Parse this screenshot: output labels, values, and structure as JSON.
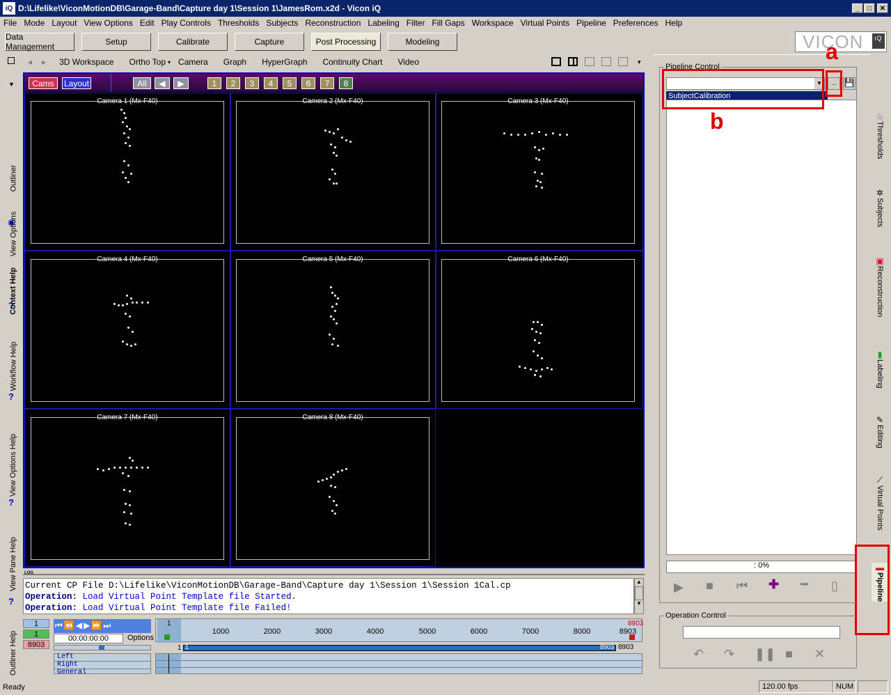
{
  "title": {
    "app_title": "D:\\Lifelike\\ViconMotionDB\\Garage-Band\\Capture day 1\\Session 1\\JamesRom.x2d - Vicon iQ",
    "logo": "iQ"
  },
  "menu": [
    "File",
    "Mode",
    "Layout",
    "View Options",
    "Edit",
    "Play Controls",
    "Thresholds",
    "Subjects",
    "Reconstruction",
    "Labeling",
    "Filter",
    "Fill Gaps",
    "Workspace",
    "Virtual Points",
    "Pipeline",
    "Preferences",
    "Help"
  ],
  "modes": [
    "Data Management",
    "Setup",
    "Calibrate",
    "Capture",
    "Post Processing",
    "Modeling"
  ],
  "brand": "VICON",
  "brand_badge": "iQ",
  "left_tabs": [
    "Outliner",
    "View Options",
    "Context Help",
    "Workflow Help",
    "View Options Help",
    "View Pane Help",
    "Outliner Help"
  ],
  "view_tabs": [
    "3D Workspace",
    "Ortho Top",
    "Camera",
    "Graph",
    "HyperGraph",
    "Continuity Chart",
    "Video"
  ],
  "cam_toolbar": {
    "cams": "Cams",
    "layout": "Layout",
    "all": "All",
    "numbers": [
      "1",
      "2",
      "3",
      "4",
      "5",
      "6",
      "7",
      "8"
    ]
  },
  "cameras": [
    "Camera 1 (Mx-F40)",
    "Camera 2 (Mx-F40)",
    "Camera 3 (Mx-F40)",
    "Camera 4 (Mx-F40)",
    "Camera 5 (Mx-F40)",
    "Camera 6 (Mx-F40)",
    "Camera 7 (Mx-F40)",
    "Camera 8 (Mx-F40)"
  ],
  "log": {
    "tag": "LOG",
    "line1": "Current CP File D:\\Lifelike\\ViconMotionDB\\Garage-Band\\Capture day 1\\Session 1\\Session 1Cal.cp",
    "op_label": "Operation:",
    "line2": "Load Virtual Point Template file Started.",
    "line3": "Load Virtual Point Template file Failed!"
  },
  "timeline": {
    "frame_current": "1",
    "frame_start": "1",
    "frame_end": "8903",
    "timecode": "00:00:00:00",
    "options": "Options",
    "ticks": [
      "1000",
      "2000",
      "3000",
      "4000",
      "5000",
      "6000",
      "7000",
      "8000",
      "8903"
    ],
    "ruler_start": "1",
    "ruler_end_top": "8903",
    "range_start": "1",
    "range_end": "8903",
    "range_end_label": "8903",
    "tracks": [
      "Left",
      "Right",
      "General"
    ]
  },
  "pipeline": {
    "group_title": "Pipeline Control",
    "dropdown_value": "",
    "browse": "...",
    "selected_item": "SubjectCalibration",
    "progress": ": 0%",
    "op_title": "Operation Control"
  },
  "right_tabs": [
    "Thresholds",
    "Subjects",
    "Reconstruction",
    "Labeling",
    "Editing",
    "Virtual Points",
    "Pipeline"
  ],
  "annotations": {
    "a": "a",
    "b": "b"
  },
  "status": {
    "ready": "Ready",
    "fps": "120.00 fps",
    "num": "NUM"
  }
}
